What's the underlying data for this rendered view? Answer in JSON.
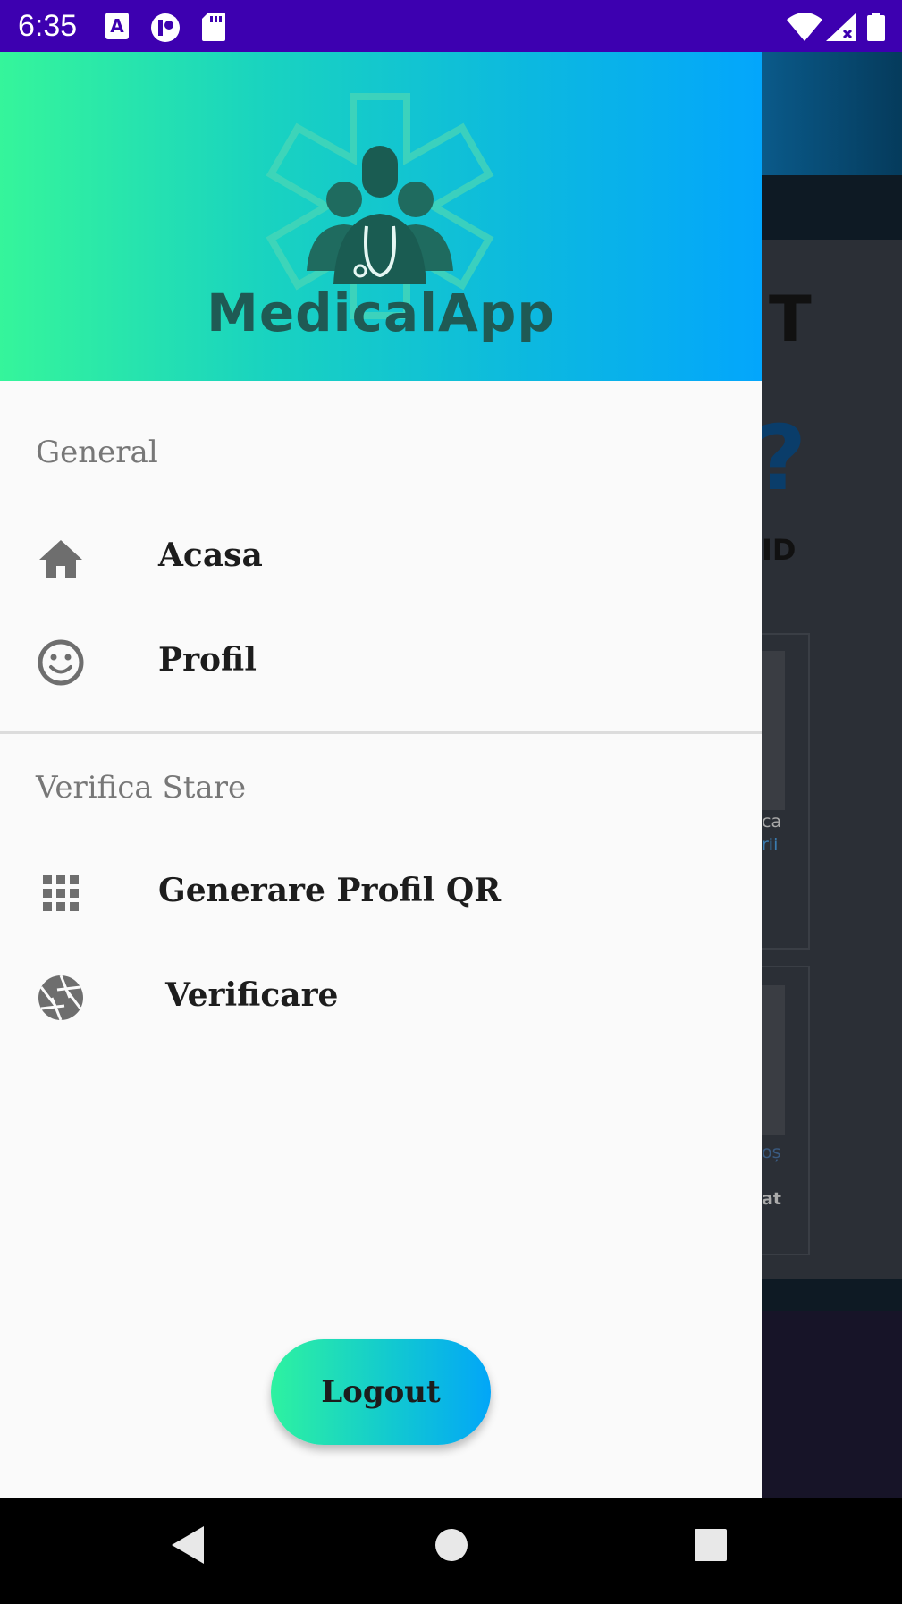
{
  "status_bar": {
    "time": "6:35"
  },
  "header": {
    "app_name": "MedicalApp"
  },
  "menu": {
    "general_title": "General",
    "items_general": [
      {
        "label": "Acasa",
        "icon": "home-icon"
      },
      {
        "label": "Profil",
        "icon": "smiley-face-icon"
      }
    ],
    "status_title": "Verifica Stare",
    "items_status": [
      {
        "label": "Generare Profil QR",
        "icon": "grid-icon"
      },
      {
        "label": "Verificare",
        "icon": "camera-aperture-icon"
      }
    ]
  },
  "logout_label": "Logout",
  "background_app": {
    "glimpses": [
      "T",
      "ID",
      "ca",
      "rii",
      "oș",
      "at"
    ]
  },
  "colors": {
    "status_bar": "#3d00b0",
    "header_start": "#35f59b",
    "header_end": "#03a6fc",
    "drawer_bg": "#fafafa",
    "section_title": "#777777",
    "item_text": "#1d1d1d"
  }
}
